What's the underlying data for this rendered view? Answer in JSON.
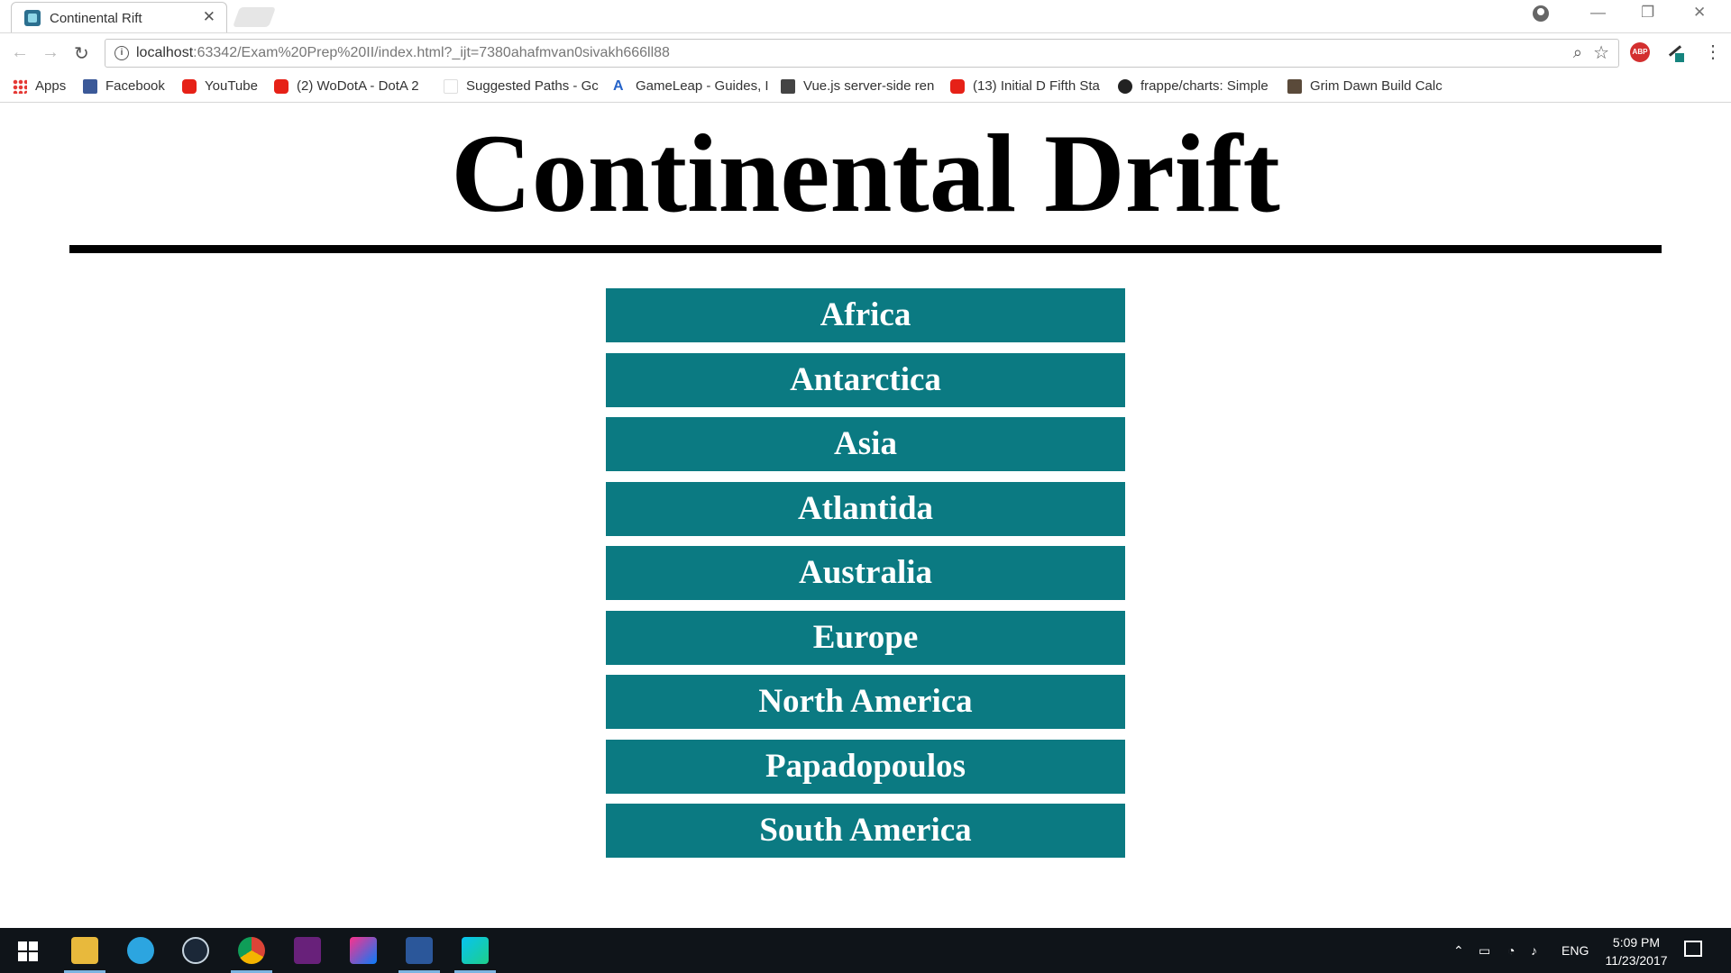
{
  "browser": {
    "tab_title": "Continental Rift",
    "url_host": "localhost",
    "url_rest": ":63342/Exam%20Prep%20II/index.html?_ijt=7380ahafmvan0sivakh666ll88",
    "bookmarks": [
      {
        "label": "Apps",
        "icon": "apps-grid-icon"
      },
      {
        "label": "Facebook",
        "icon": "facebook-icon"
      },
      {
        "label": "YouTube",
        "icon": "youtube-icon"
      },
      {
        "label": "(2) WoDotA - DotA 2",
        "icon": "youtube-icon"
      },
      {
        "label": "Suggested Paths - Gc",
        "icon": "google-icon"
      },
      {
        "label": "GameLeap - Guides, I",
        "icon": "gameleap-icon"
      },
      {
        "label": "Vue.js server-side ren",
        "icon": "image-icon"
      },
      {
        "label": "(13) Initial D Fifth Sta",
        "icon": "youtube-icon"
      },
      {
        "label": "frappe/charts: Simple",
        "icon": "github-icon"
      },
      {
        "label": "Grim Dawn Build Calc",
        "icon": "grimdawn-icon"
      }
    ]
  },
  "page": {
    "heading": "Continental Drift",
    "continents": [
      "Africa",
      "Antarctica",
      "Asia",
      "Atlantida",
      "Australia",
      "Europe",
      "North America",
      "Papadopoulos",
      "South America"
    ],
    "button_color": "#0b7a82"
  },
  "taskbar": {
    "language": "ENG",
    "time": "5:09 PM",
    "date": "11/23/2017"
  }
}
